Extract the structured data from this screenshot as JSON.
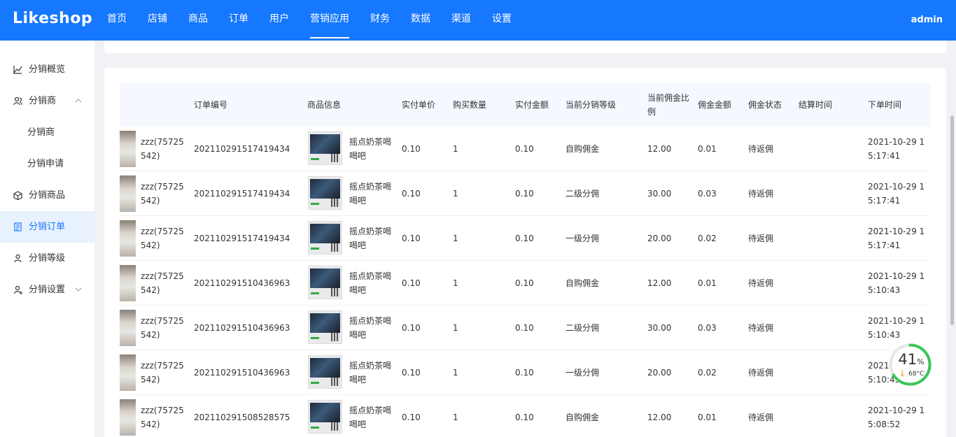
{
  "header": {
    "logo": "Likeshop",
    "nav": [
      "首页",
      "店铺",
      "商品",
      "订单",
      "用户",
      "营销应用",
      "财务",
      "数据",
      "渠道",
      "设置"
    ],
    "active_nav": "营销应用",
    "user": "admin"
  },
  "sidebar": {
    "items": [
      {
        "label": "分销概览",
        "icon": "chart-line-icon"
      },
      {
        "label": "分销商",
        "icon": "users-icon",
        "expanded": true
      },
      {
        "label": "分销商",
        "sub": true
      },
      {
        "label": "分销申请",
        "sub": true
      },
      {
        "label": "分销商品",
        "icon": "box-icon"
      },
      {
        "label": "分销订单",
        "icon": "order-icon",
        "active": true
      },
      {
        "label": "分销等级",
        "icon": "user-level-icon"
      },
      {
        "label": "分销设置",
        "icon": "user-settings-icon",
        "collapsed": true
      }
    ]
  },
  "table": {
    "headers": [
      "订单编号",
      "商品信息",
      "实付单价",
      "购买数量",
      "实付金额",
      "当前分销等级",
      "当前佣金比例",
      "佣金金额",
      "佣金状态",
      "结算时间",
      "下单时间"
    ],
    "rows": [
      {
        "user": "zzz(75725542)",
        "order_no": "202110291517419434",
        "goods": "摇点奶茶喝喝吧",
        "price": "0.10",
        "qty": "1",
        "paid": "0.10",
        "level": "自购佣金",
        "ratio": "12.00",
        "commission": "0.01",
        "status": "待返佣",
        "settle_time": "",
        "order_time": "2021-10-29 15:17:41"
      },
      {
        "user": "zzz(75725542)",
        "order_no": "202110291517419434",
        "goods": "摇点奶茶喝喝吧",
        "price": "0.10",
        "qty": "1",
        "paid": "0.10",
        "level": "二级分佣",
        "ratio": "30.00",
        "commission": "0.03",
        "status": "待返佣",
        "settle_time": "",
        "order_time": "2021-10-29 15:17:41"
      },
      {
        "user": "zzz(75725542)",
        "order_no": "202110291517419434",
        "goods": "摇点奶茶喝喝吧",
        "price": "0.10",
        "qty": "1",
        "paid": "0.10",
        "level": "一级分佣",
        "ratio": "20.00",
        "commission": "0.02",
        "status": "待返佣",
        "settle_time": "",
        "order_time": "2021-10-29 15:17:41"
      },
      {
        "user": "zzz(75725542)",
        "order_no": "202110291510436963",
        "goods": "摇点奶茶喝喝吧",
        "price": "0.10",
        "qty": "1",
        "paid": "0.10",
        "level": "自购佣金",
        "ratio": "12.00",
        "commission": "0.01",
        "status": "待返佣",
        "settle_time": "",
        "order_time": "2021-10-29 15:10:43"
      },
      {
        "user": "zzz(75725542)",
        "order_no": "202110291510436963",
        "goods": "摇点奶茶喝喝吧",
        "price": "0.10",
        "qty": "1",
        "paid": "0.10",
        "level": "二级分佣",
        "ratio": "30.00",
        "commission": "0.03",
        "status": "待返佣",
        "settle_time": "",
        "order_time": "2021-10-29 15:10:43"
      },
      {
        "user": "zzz(75725542)",
        "order_no": "202110291510436963",
        "goods": "摇点奶茶喝喝吧",
        "price": "0.10",
        "qty": "1",
        "paid": "0.10",
        "level": "一级分佣",
        "ratio": "20.00",
        "commission": "0.02",
        "status": "待返佣",
        "settle_time": "",
        "order_time": "2021-10-29 15:10:43"
      },
      {
        "user": "zzz(75725542)",
        "order_no": "202110291508528575",
        "goods": "摇点奶茶喝喝吧",
        "price": "0.10",
        "qty": "1",
        "paid": "0.10",
        "level": "自购佣金",
        "ratio": "12.00",
        "commission": "0.01",
        "status": "待返佣",
        "settle_time": "",
        "order_time": "2021-10-29 15:08:52"
      }
    ]
  },
  "monitor": {
    "percent": 41,
    "percent_text": "41",
    "percent_unit": "%",
    "temp": "68°C",
    "ring_color": "#3cc55a"
  }
}
